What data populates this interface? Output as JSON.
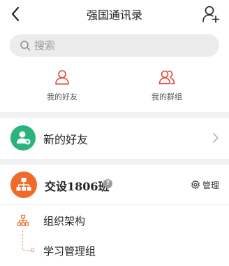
{
  "header": {
    "title": "强国通讯录"
  },
  "search": {
    "placeholder": "搜索",
    "value": ""
  },
  "quick_actions": [
    {
      "label": "我的好友",
      "icon": "person-icon"
    },
    {
      "label": "我的群组",
      "icon": "people-icon"
    }
  ],
  "new_friend": {
    "label": "新的好友"
  },
  "group": {
    "name": "交设1806班",
    "manage_label": "管理"
  },
  "org": {
    "label": "组织架构",
    "sub_label": "学习管理组"
  },
  "colors": {
    "accent_red": "#e0453a",
    "green": "#2bb37b",
    "orange": "#f06b2a",
    "tree_orange": "#f0a57a"
  }
}
